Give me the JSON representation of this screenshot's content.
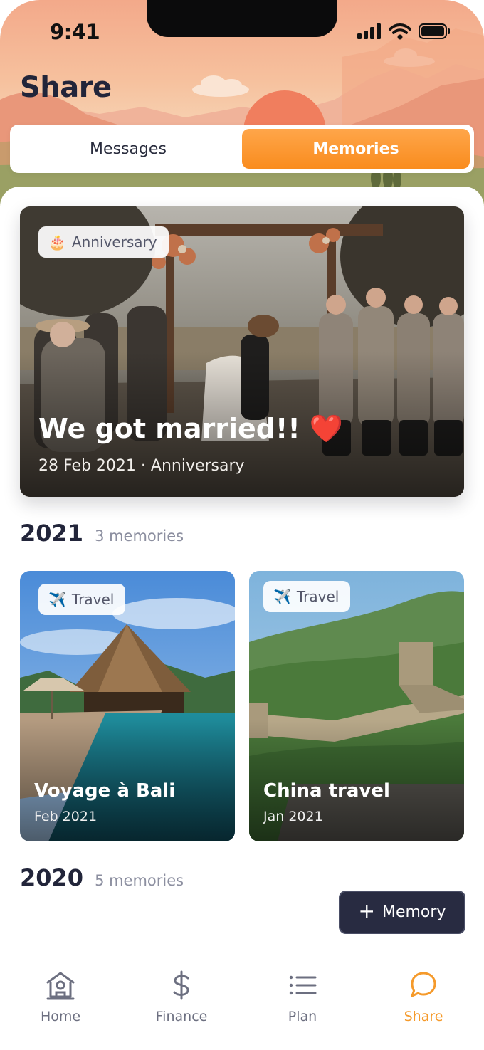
{
  "status_bar": {
    "time": "9:41"
  },
  "header": {
    "title": "Share"
  },
  "tabs": [
    {
      "label": "Messages",
      "active": false
    },
    {
      "label": "Memories",
      "active": true
    }
  ],
  "featured": {
    "tag": {
      "icon": "cake-icon",
      "emoji": "🎂",
      "label": "Anniversary"
    },
    "title": "We got married!! ❤️",
    "subtitle": "28 Feb 2021 · Anniversary"
  },
  "sections": [
    {
      "year": "2021",
      "count": "3 memories",
      "cards": [
        {
          "tag": {
            "icon": "airplane-icon",
            "emoji": "✈️",
            "label": "Travel"
          },
          "title": "Voyage à Bali",
          "date": "Feb 2021"
        },
        {
          "tag": {
            "icon": "airplane-icon",
            "emoji": "✈️",
            "label": "Travel"
          },
          "title": "China travel",
          "date": "Jan 2021"
        }
      ]
    },
    {
      "year": "2020",
      "count": "5 memories"
    }
  ],
  "add_button": {
    "label": "Memory",
    "icon": "plus-icon"
  },
  "bottom_nav": [
    {
      "label": "Home",
      "icon": "home-icon",
      "active": false
    },
    {
      "label": "Finance",
      "icon": "dollar-icon",
      "active": false
    },
    {
      "label": "Plan",
      "icon": "list-icon",
      "active": false
    },
    {
      "label": "Share",
      "icon": "chat-bubble-icon",
      "active": true
    }
  ],
  "colors": {
    "accent": "#f98c1e",
    "dark_button": "#282b41",
    "text_primary": "#22253a",
    "text_muted": "#8c8fa0"
  }
}
